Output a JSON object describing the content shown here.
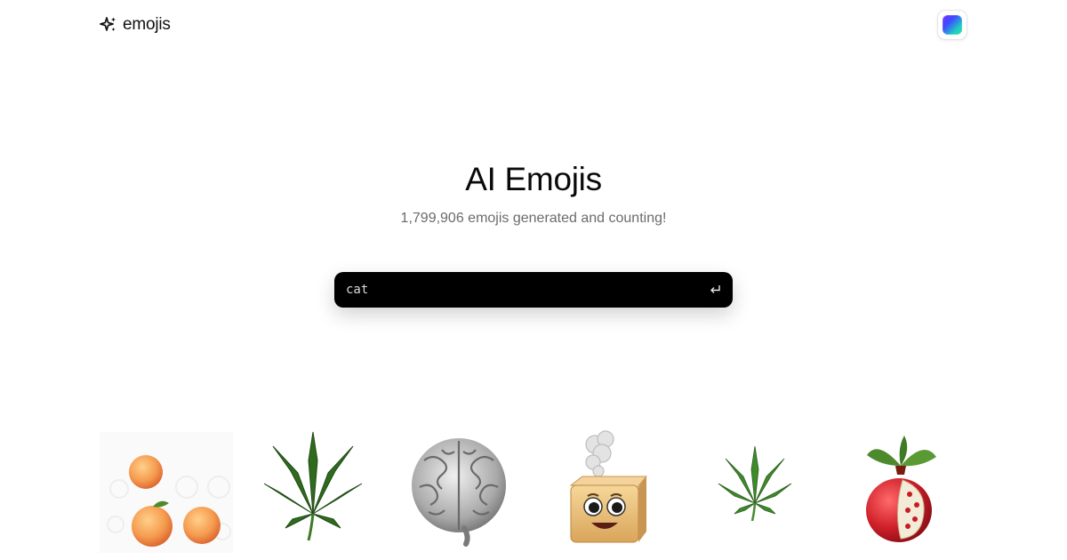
{
  "header": {
    "brand_name": "emojis",
    "brand_icon": "sparkles-icon",
    "avatar_icon": "gradient-avatar"
  },
  "hero": {
    "title": "AI Emojis",
    "subtitle": "1,799,906 emojis generated and counting!"
  },
  "search": {
    "value": "cat",
    "submit_icon": "enter-return-icon"
  },
  "emojis": [
    {
      "name": "peaches"
    },
    {
      "name": "cannabis-leaf"
    },
    {
      "name": "brain"
    },
    {
      "name": "smoking-tofu-block"
    },
    {
      "name": "cannabis-leaf-small"
    },
    {
      "name": "pomegranate"
    }
  ],
  "colors": {
    "background": "#ffffff",
    "search_bg": "#000000",
    "subtitle": "#6b6b6b"
  }
}
